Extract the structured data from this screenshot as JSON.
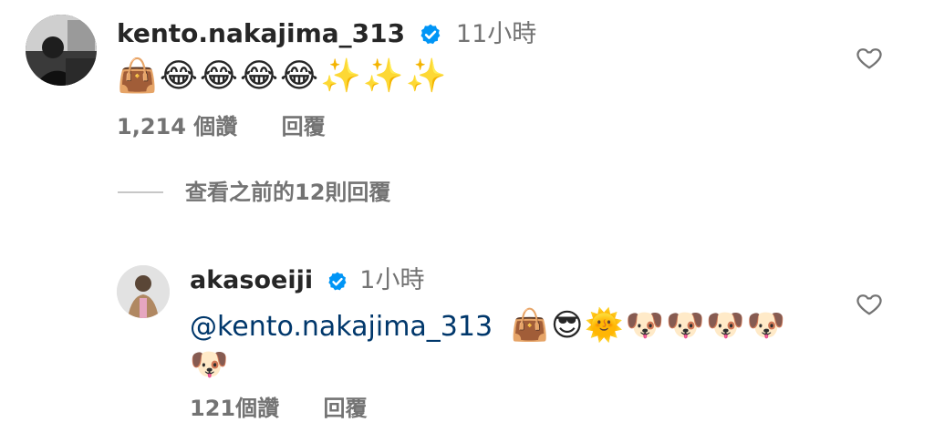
{
  "comment1": {
    "username": "kento.nakajima_313",
    "time": "11小時",
    "emojis": "👜😂😂😂😂✨✨✨",
    "likes": "1,214 個讚",
    "reply": "回覆"
  },
  "view_replies": "查看之前的12則回覆",
  "comment2": {
    "username": "akasoeiji",
    "time": "1小時",
    "mention": "@kento.nakajima_313",
    "emojis_line1": "👜😎🌞🐶🐶🐶🐶",
    "emojis_line2": "🐶",
    "likes": "121個讚",
    "reply": "回覆"
  },
  "icons": {
    "verified": "verified-badge-icon",
    "like": "heart-icon"
  },
  "colors": {
    "verified_blue": "#0095f6",
    "mention": "#00376b",
    "meta_gray": "#737373"
  }
}
